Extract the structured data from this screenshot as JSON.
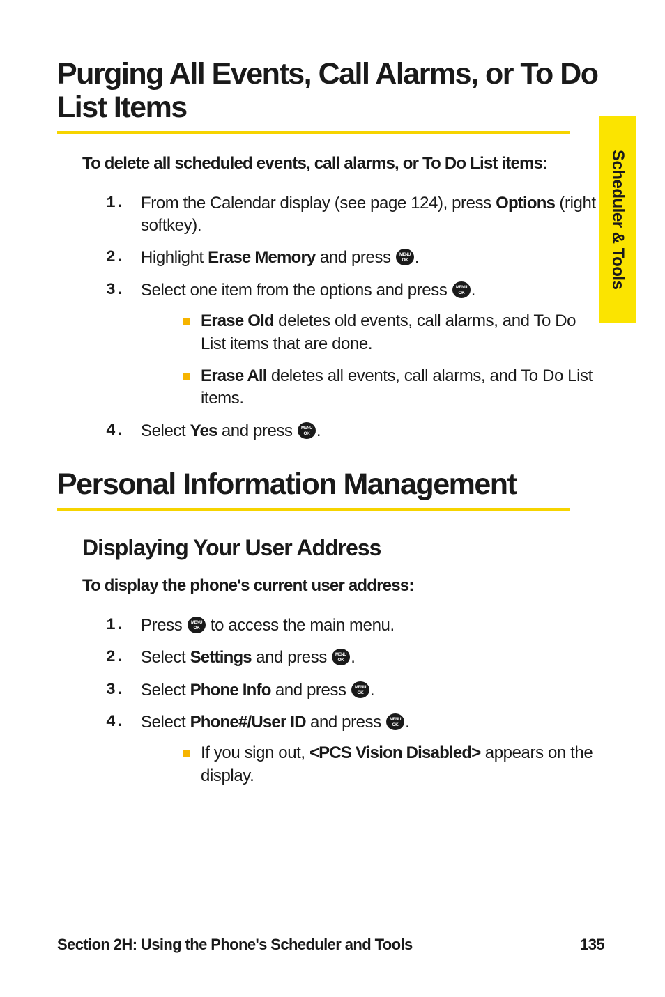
{
  "sideTab": "Scheduler & Tools",
  "h1": "Purging All Events, Call Alarms, or To Do List Items",
  "lead1": "To delete all scheduled events, call alarms, or To Do List items:",
  "steps1": {
    "s1_a": "From the Calendar display (see page 124), press ",
    "s1_b": "Options",
    "s1_c": " (right softkey).",
    "s2_a": "Highlight ",
    "s2_b": "Erase Memory",
    "s2_c": " and press ",
    "s3_a": "Select one item from the options and press ",
    "s3_sub1_b": "Erase Old",
    "s3_sub1_c": " deletes old events, call alarms, and To Do List items that are done.",
    "s3_sub2_b": "Erase All",
    "s3_sub2_c": " deletes all events, call alarms, and To Do List items.",
    "s4_a": "Select ",
    "s4_b": "Yes",
    "s4_c": " and press "
  },
  "h1b": "Personal Information Management",
  "h2": "Displaying Your User Address",
  "lead2": "To display the phone's current user address:",
  "steps2": {
    "s1_a": "Press ",
    "s1_c": " to access the main menu.",
    "s2_a": "Select ",
    "s2_b": "Settings",
    "s2_c": " and press ",
    "s3_a": "Select ",
    "s3_b": "Phone Info",
    "s3_c": " and press ",
    "s4_a": "Select ",
    "s4_b": "Phone#/User ID",
    "s4_c": " and press ",
    "s4_sub_a": "If you sign out, ",
    "s4_sub_b": "<PCS Vision Disabled>",
    "s4_sub_c": " appears on the display."
  },
  "period": ".",
  "footer": {
    "left": "Section 2H: Using the Phone's Scheduler and Tools",
    "right": "135"
  },
  "icon_name": "menu-ok-button-icon"
}
